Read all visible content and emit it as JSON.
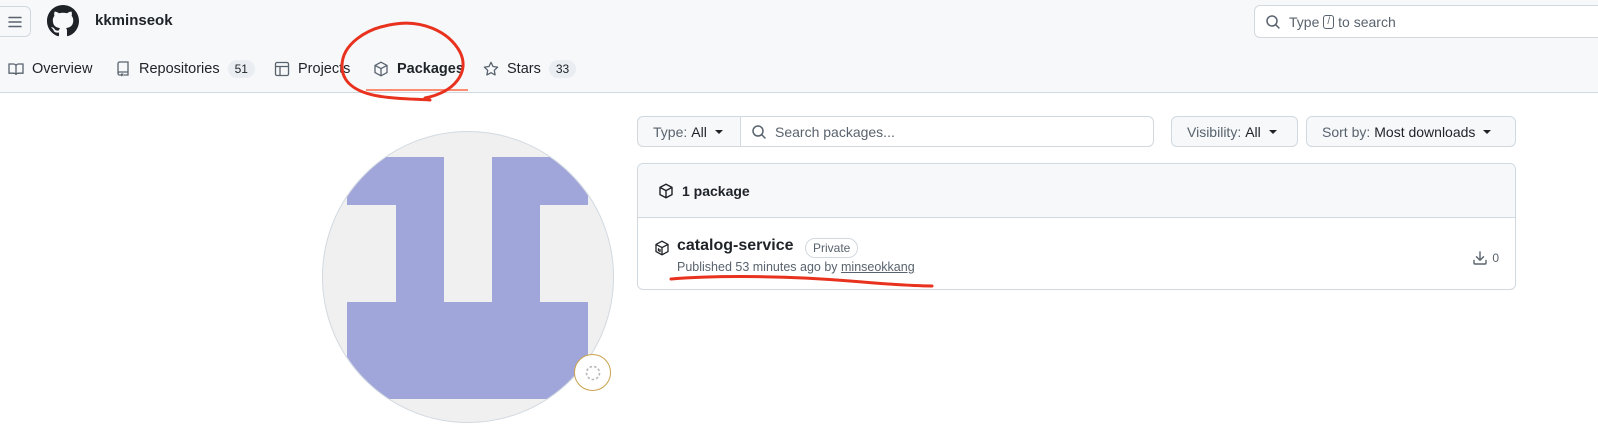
{
  "header": {
    "username": "kkminseok",
    "search": {
      "before": "Type",
      "key": "/",
      "after": "to search"
    }
  },
  "nav": {
    "tabs": [
      {
        "label": "Overview",
        "icon": "book-icon"
      },
      {
        "label": "Repositories",
        "count": "51",
        "icon": "repo-icon"
      },
      {
        "label": "Projects",
        "icon": "table-icon"
      },
      {
        "label": "Packages",
        "icon": "package-icon",
        "active": true
      },
      {
        "label": "Stars",
        "count": "33",
        "icon": "star-icon"
      }
    ]
  },
  "filters": {
    "type_label": "Type:",
    "type_value": "All",
    "search_placeholder": "Search packages...",
    "visibility_label": "Visibility:",
    "visibility_value": "All",
    "sort_label": "Sort by:",
    "sort_value": "Most downloads"
  },
  "packages": {
    "count_label": "1 package",
    "items": [
      {
        "name": "catalog-service",
        "visibility": "Private",
        "published": "Published 53 minutes ago by",
        "author": "minseokkang",
        "downloads": "0"
      }
    ]
  },
  "colors": {
    "accent_underline": "#fd8c73",
    "avatar": "#a0a6da",
    "annotation": "#e8321e"
  }
}
